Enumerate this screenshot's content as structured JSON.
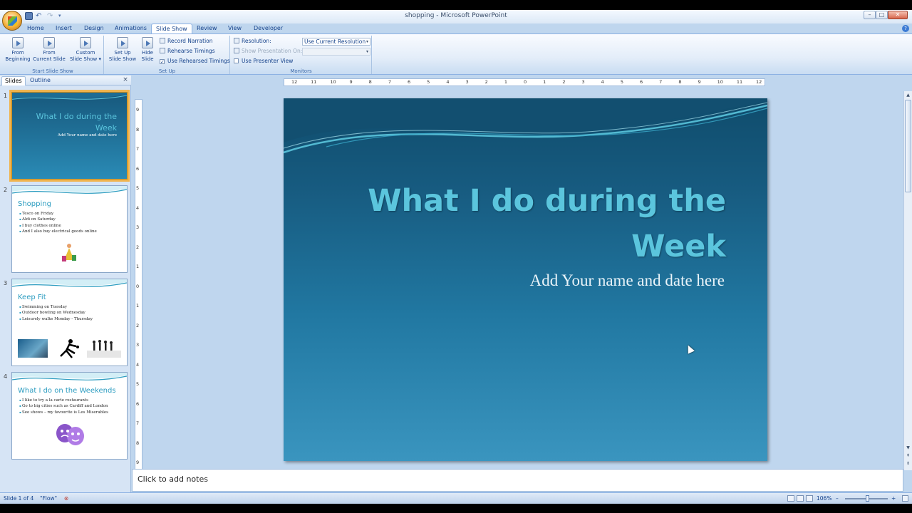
{
  "window": {
    "title": "shopping - Microsoft PowerPoint",
    "min": "–",
    "max": "□",
    "close": "✕"
  },
  "qat": {
    "undo": "↶",
    "redo": "↷",
    "more": "▾"
  },
  "tabs": [
    "Home",
    "Insert",
    "Design",
    "Animations",
    "Slide Show",
    "Review",
    "View",
    "Developer"
  ],
  "active_tab": "Slide Show",
  "ribbon": {
    "start_group": {
      "label": "Start Slide Show",
      "from_beginning_1": "From",
      "from_beginning_2": "Beginning",
      "from_current_1": "From",
      "from_current_2": "Current Slide",
      "custom_1": "Custom",
      "custom_2": "Slide Show ▾"
    },
    "setup_group": {
      "label": "Set Up",
      "setup_1": "Set Up",
      "setup_2": "Slide Show",
      "hide_1": "Hide",
      "hide_2": "Slide",
      "record": "Record Narration",
      "rehearse": "Rehearse Timings",
      "use_rehearsed": "Use Rehearsed Timings",
      "use_rehearsed_checked": true
    },
    "monitors_group": {
      "label": "Monitors",
      "resolution_label": "Resolution:",
      "resolution_value": "Use Current Resolution",
      "show_on_label": "Show Presentation On:",
      "show_on_value": "",
      "presenter_view": "Use Presenter View",
      "presenter_view_checked": false
    }
  },
  "pane": {
    "tab_slides": "Slides",
    "tab_outline": "Outline",
    "close": "×"
  },
  "thumbnails": [
    {
      "num": "1",
      "title": "What I do during the Week",
      "subtitle": "Add Your name and date here"
    },
    {
      "num": "2",
      "title": "Shopping",
      "bullets": [
        "Tesco on Friday",
        "Aldi on Saturday",
        "I buy clothes online",
        "And I also buy electrical goods online"
      ]
    },
    {
      "num": "3",
      "title": "Keep Fit",
      "bullets": [
        "Swimming on Tuesday",
        "Outdoor bowling on Wednesday",
        "Leisurely walks Monday - Thursday"
      ]
    },
    {
      "num": "4",
      "title": "What I do on the Weekends",
      "bullets": [
        "I like to try a la carte restaurants",
        "Go to big cities such as Cardiff and London",
        "See shows – my favourite is Les Miserables"
      ]
    }
  ],
  "ruler": {
    "h_ticks": [
      "12",
      "11",
      "10",
      "9",
      "8",
      "7",
      "6",
      "5",
      "4",
      "3",
      "2",
      "1",
      "0",
      "1",
      "2",
      "3",
      "4",
      "5",
      "6",
      "7",
      "8",
      "9",
      "10",
      "11",
      "12"
    ],
    "v_ticks": [
      "9",
      "8",
      "7",
      "6",
      "5",
      "4",
      "3",
      "2",
      "1",
      "0",
      "1",
      "2",
      "3",
      "4",
      "5",
      "6",
      "7",
      "8",
      "9"
    ]
  },
  "slide": {
    "title": "What I do during the Week",
    "subtitle": "Add Your name and date here"
  },
  "notes": {
    "placeholder": "Click to add notes"
  },
  "status": {
    "slide_of": "Slide 1 of 4",
    "theme": "\"Flow\"",
    "zoom": "106%",
    "zoom_minus": "–",
    "zoom_plus": "+",
    "zoom_level": 0.53
  },
  "colors": {
    "title": "#5bc5dd",
    "ribbon_text": "#15428b",
    "selection": "#f0b44e"
  }
}
